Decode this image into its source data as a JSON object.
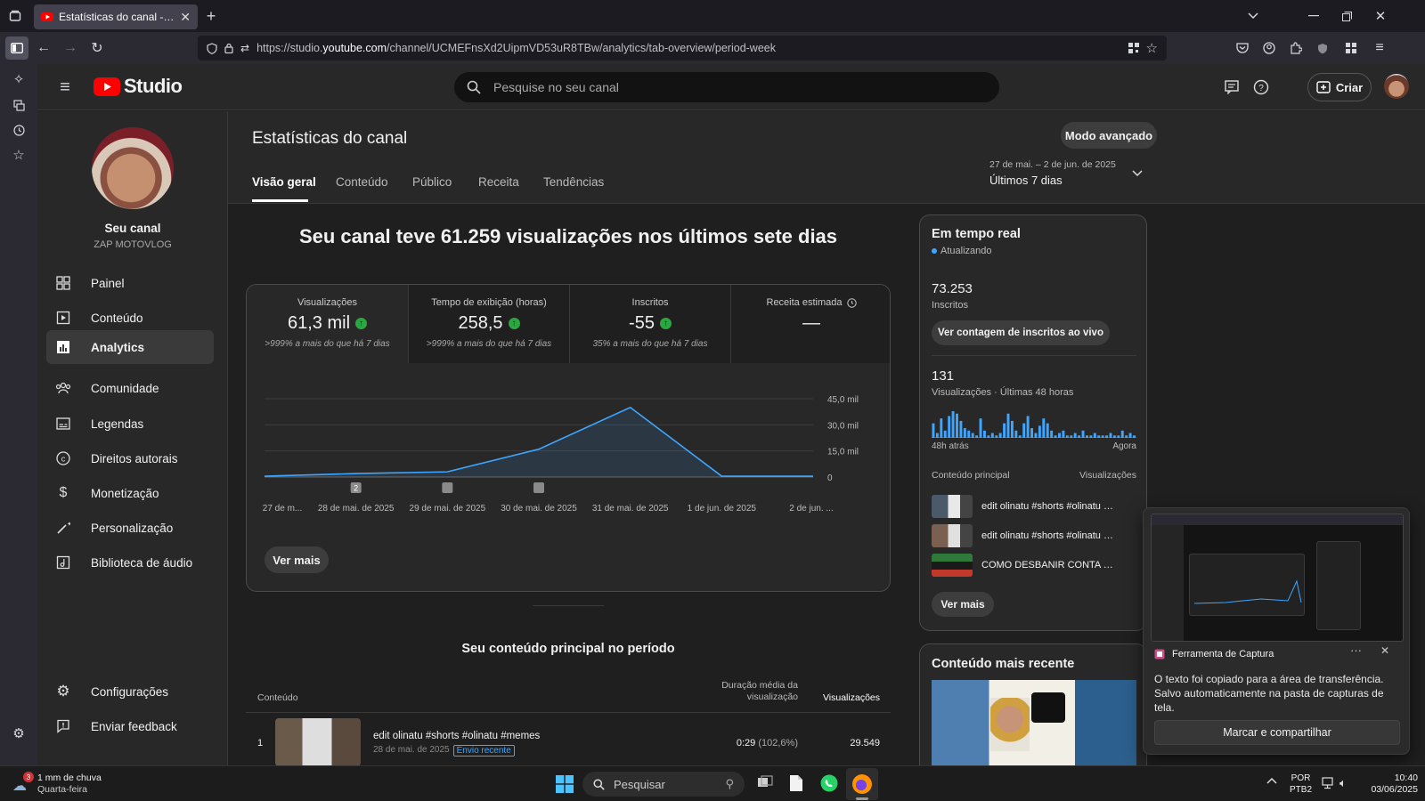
{
  "browser": {
    "tab_title": "Estatísticas do canal - YouTube",
    "url_prefix": "https://studio.",
    "url_host": "youtube.com",
    "url_path": "/channel/UCMEFnsXd2UipmVD53uR8TBw/analytics/tab-overview/period-week"
  },
  "header": {
    "logo_text": "Studio",
    "search_placeholder": "Pesquise no seu canal",
    "create_label": "Criar"
  },
  "sidebar": {
    "channel_title": "Seu canal",
    "channel_name": "ZAP MOTOVLOG",
    "items": [
      {
        "label": "Painel"
      },
      {
        "label": "Conteúdo"
      },
      {
        "label": "Analytics"
      },
      {
        "label": "Comunidade"
      },
      {
        "label": "Legendas"
      },
      {
        "label": "Direitos autorais"
      },
      {
        "label": "Monetização"
      },
      {
        "label": "Personalização"
      },
      {
        "label": "Biblioteca de áudio"
      }
    ],
    "bottom": [
      {
        "label": "Configurações"
      },
      {
        "label": "Enviar feedback"
      }
    ]
  },
  "page": {
    "title": "Estatísticas do canal",
    "advanced_label": "Modo avançado",
    "tabs": [
      "Visão geral",
      "Conteúdo",
      "Público",
      "Receita",
      "Tendências"
    ],
    "date_range": "27 de mai. – 2 de jun. de 2025",
    "date_label": "Últimos 7 dias",
    "headline": "Seu canal teve 61.259 visualizações nos últimos sete dias"
  },
  "metrics": [
    {
      "label": "Visualizações",
      "value": "61,3 mil",
      "delta": ">999% a mais do que há 7 dias",
      "up": true
    },
    {
      "label": "Tempo de exibição (horas)",
      "value": "258,5",
      "delta": ">999% a mais do que há 7 dias",
      "up": true
    },
    {
      "label": "Inscritos",
      "value": "-55",
      "delta": "35% a mais do que há 7 dias",
      "up": true
    },
    {
      "label": "Receita estimada",
      "value": "—",
      "delta": "",
      "up": false
    }
  ],
  "chart_data": {
    "type": "area",
    "x": [
      "27 de m...",
      "28 de mai. de 2025",
      "29 de mai. de 2025",
      "30 de mai. de 2025",
      "31 de mai. de 2025",
      "1 de jun. de 2025",
      "2 de jun. ..."
    ],
    "series": [
      {
        "values": [
          500,
          2000,
          3000,
          16000,
          40000,
          500,
          500
        ]
      }
    ],
    "yticks": [
      "0",
      "15,0 mil",
      "30,0 mil",
      "45,0 mil"
    ],
    "ylim": [
      0,
      45000
    ],
    "markers": [
      "2"
    ],
    "line_color": "#3ea6ff",
    "grid": true
  },
  "see_more": "Ver mais",
  "top_content": {
    "title": "Seu conteúdo principal no período",
    "col_content": "Conteúdo",
    "col_duration": "Duração média da visualização",
    "col_views": "Visualizações",
    "rows": [
      {
        "rank": "1",
        "title": "edit olinatu #shorts #olinatu #memes",
        "date": "28 de mai. de 2025",
        "badge": "Envio recente",
        "duration": "0:29",
        "pct": "(102,6%)",
        "views": "29.549"
      }
    ]
  },
  "realtime": {
    "title": "Em tempo real",
    "status": "Atualizando",
    "subs_value": "73.253",
    "subs_label": "Inscritos",
    "live_button": "Ver contagem de inscritos ao vivo",
    "views_value": "131",
    "views_label": "Visualizações · Últimas 48 horas",
    "spark_left": "48h atrás",
    "spark_right": "Agora",
    "spark_values": [
      6,
      2,
      8,
      3,
      9,
      11,
      10,
      7,
      4,
      3,
      2,
      1,
      8,
      3,
      1,
      2,
      1,
      2,
      6,
      10,
      7,
      3,
      1,
      6,
      9,
      4,
      2,
      5,
      8,
      6,
      3,
      1,
      2,
      3,
      1,
      1,
      2,
      1,
      3,
      1,
      1,
      2,
      1,
      1,
      1,
      2,
      1,
      1,
      3,
      1,
      2,
      1
    ],
    "top_label": "Conteúdo principal",
    "top_views_label": "Visualizações",
    "items": [
      {
        "title": "edit olinatu #shorts #olinatu #memes"
      },
      {
        "title": "edit olinatu #shorts #olinatu #memes"
      },
      {
        "title": "COMO DESBANIR CONTA DO WHATSAPP"
      }
    ],
    "see_more": "Ver mais"
  },
  "recent": {
    "title": "Conteúdo mais recente"
  },
  "snip": {
    "app_name": "Ferramenta de Captura",
    "message_1": "O texto foi copiado para a área de transferência.",
    "message_2": "Salvo automaticamente na pasta de capturas de tela.",
    "button": "Marcar e compartilhar"
  },
  "taskbar": {
    "weather_text": "1 mm de chuva",
    "weather_day": "Quarta-feira",
    "weather_badge": "3",
    "search_label": "Pesquisar",
    "lang": "POR",
    "layout": "PTB2",
    "time": "10:40",
    "date": "03/06/2025"
  }
}
